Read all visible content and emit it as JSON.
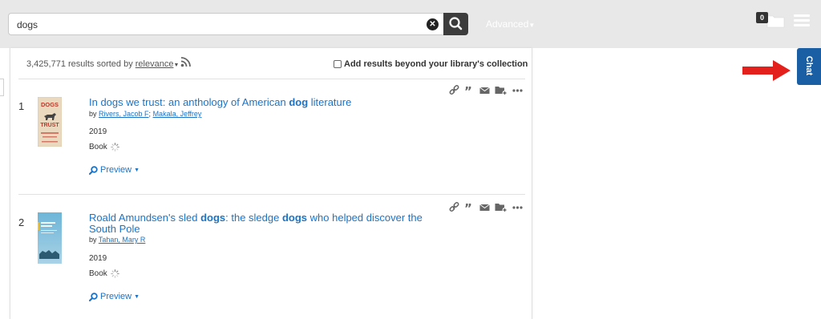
{
  "search": {
    "value": "dogs",
    "advanced_label": "Advanced"
  },
  "header": {
    "folder_count": "0"
  },
  "results_header": {
    "count_text": "3,425,771 results sorted by ",
    "sort_label": "relevance",
    "beyond_label": "Add results beyond your library's collection"
  },
  "results": [
    {
      "number": "1",
      "title_parts": [
        "In dogs we trust: an anthology of American ",
        "dog",
        " literature"
      ],
      "by": "by ",
      "authors": [
        "Rivers, Jacob F",
        "Makala, Jeffrey"
      ],
      "year": "2019",
      "format": "Book",
      "preview_label": "Preview",
      "cover_text": [
        "DOGS",
        "TRUST"
      ]
    },
    {
      "number": "2",
      "title_parts": [
        "Roald Amundsen's sled ",
        "dogs",
        ": the sledge ",
        "dogs",
        " who helped discover the South Pole"
      ],
      "by": "by ",
      "authors": [
        "Tahan, Mary R"
      ],
      "year": "2019",
      "format": "Book",
      "preview_label": "Preview"
    }
  ],
  "chat": {
    "label": "Chat"
  },
  "colors": {
    "link": "#1a73c8",
    "chat_tab": "#1a5ea4",
    "arrow": "#e3201b",
    "topbar": "#e8e8e8"
  }
}
